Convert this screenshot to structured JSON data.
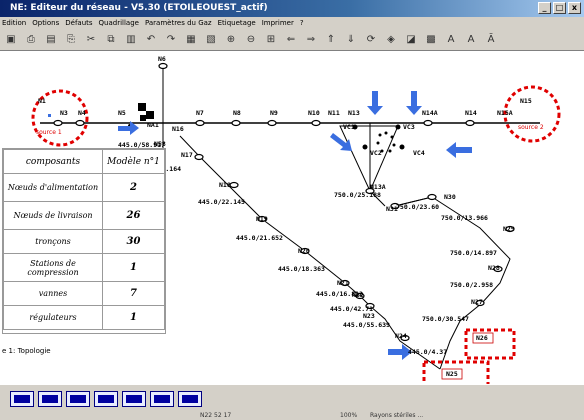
{
  "window": {
    "title": "NE: Editeur du réseau - V5.30 (ETOILEOUEST_actif)",
    "controls": [
      "_",
      "□",
      "x"
    ]
  },
  "menu": [
    "Edition",
    "Options",
    "Défauts",
    "Quadrillage",
    "Paramètres du Gaz",
    "Etiquetage",
    "Imprimer",
    "?"
  ],
  "table": {
    "headers": [
      "composants",
      "Modèle n°1"
    ],
    "rows": [
      {
        "label": "Nœuds d'alimentation",
        "value": "2"
      },
      {
        "label": "Nœuds de livraison",
        "value": "26"
      },
      {
        "label": "tronçons",
        "value": "30"
      },
      {
        "label": "Stations de compression",
        "value": "1"
      },
      {
        "label": "vannes",
        "value": "7"
      },
      {
        "label": "régulateurs",
        "value": "1"
      }
    ]
  },
  "tab_label": "e 1: Topologie",
  "nodes": {
    "N1": "N1",
    "N3": "N3",
    "N4": "N4",
    "N5": "N5",
    "N6": "N6",
    "N7": "N7",
    "N8": "N8",
    "N9": "N9",
    "N10": "N10",
    "N11": "N11",
    "N13": "N13",
    "N13A": "N13A",
    "N14A": "N14A",
    "N14": "N14",
    "N15": "N15",
    "N15A": "N15A",
    "N16": "N16",
    "N17": "N17",
    "N18": "N18",
    "N19": "N19",
    "N20": "N20",
    "N21": "N21",
    "N22": "N22",
    "N23": "N23",
    "N24": "N24",
    "N25": "N25",
    "N26": "N26",
    "N27": "N27",
    "N28": "N28",
    "N29": "N29",
    "N30": "N30",
    "N31": "N31",
    "NA1": "NA1",
    "N58": "N58",
    "VC1": "VC1",
    "VC2": "VC2",
    "VC3": "VC3",
    "VC4": "VC4"
  },
  "sources": {
    "left": "source 1",
    "right": "source 2"
  },
  "edges": {
    "e1": "445.0/58.917",
    "e2": "445.0/6.164",
    "e3": "445.0/22.145",
    "e4": "445.0/21.652",
    "e5": "445.0/18.363",
    "e6": "445.0/16.812",
    "e7": "445.0/42.71",
    "e8": "445.0/55.639",
    "e9": "445.0/4.37",
    "e10": "750.0/25.188",
    "e11": "750.0/23.60",
    "e12": "750.0/13.966",
    "e13": "750.0/14.897",
    "e14": "750.0/2.958",
    "e15": "750.0/30.547"
  },
  "status": {
    "coords": "N22     52 17",
    "zoom": "100%",
    "message": "Rayons stériles  ..."
  }
}
